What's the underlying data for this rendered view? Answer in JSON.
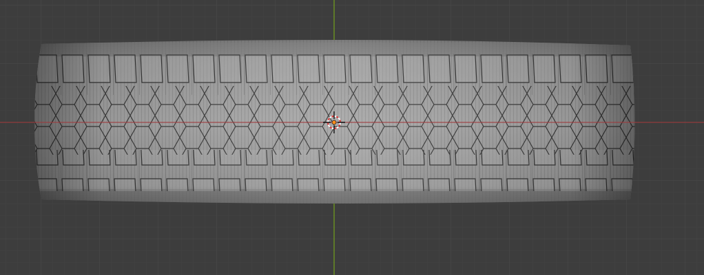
{
  "viewport": {
    "background_color": "#3d3d3d",
    "grid_minor_color": "#444444",
    "grid_major_color": "#4a4a4a",
    "x_axis_color": "#a0393c",
    "y_axis_color": "#6f9a1f",
    "object": {
      "name_icon": "tire-mesh",
      "fill_color": "#8a8a8a",
      "wire_color": "#2a2a2a"
    },
    "cursor_icon": "3d-cursor-icon",
    "origin_color": "#ff8c1a"
  }
}
